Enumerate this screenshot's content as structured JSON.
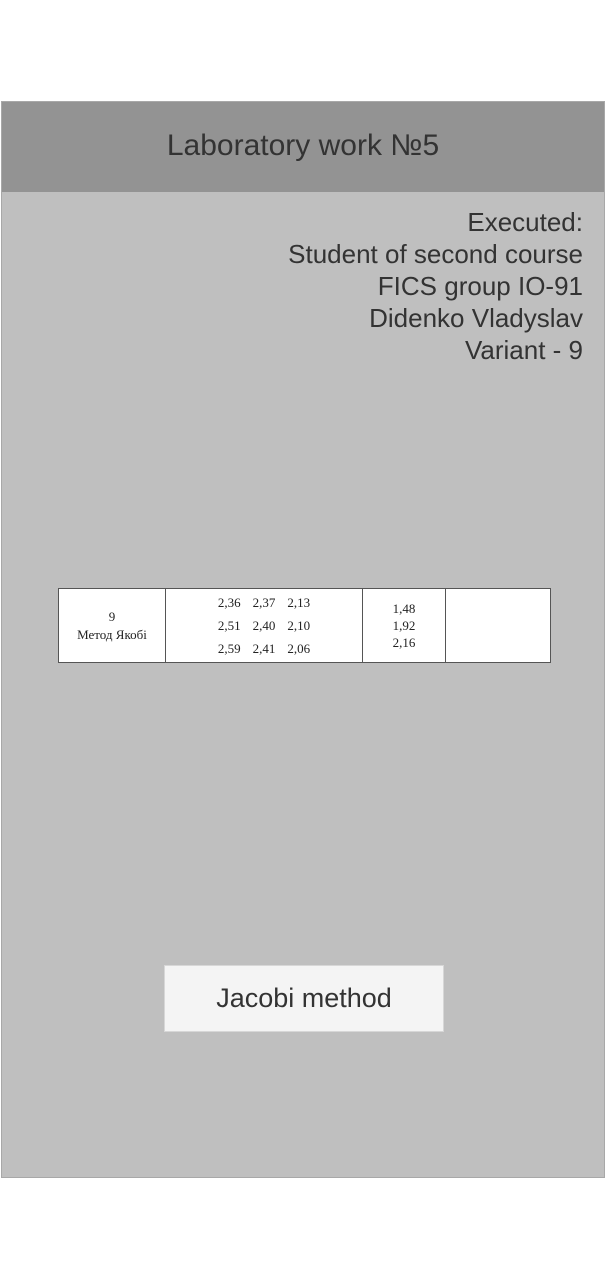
{
  "header": {
    "title": "Laboratory work №5"
  },
  "executed": {
    "lines": [
      "Executed:",
      "Student of second course",
      "FICS group IO-91",
      "Didenko Vladyslav",
      "Variant - 9"
    ]
  },
  "task_table": {
    "variant": "9",
    "method": "Метод Якобі",
    "matrix": [
      [
        "2,36",
        "2,37",
        "2,13"
      ],
      [
        "2,51",
        "2,40",
        "2,10"
      ],
      [
        "2,59",
        "2,41",
        "2,06"
      ]
    ],
    "vector": [
      "1,48",
      "1,92",
      "2,16"
    ],
    "extra": ""
  },
  "button": {
    "label": "Jacobi method"
  },
  "colors": {
    "background": "#bfbfbf",
    "header": "#939393",
    "button": "#f4f4f4",
    "text": "#333333"
  }
}
